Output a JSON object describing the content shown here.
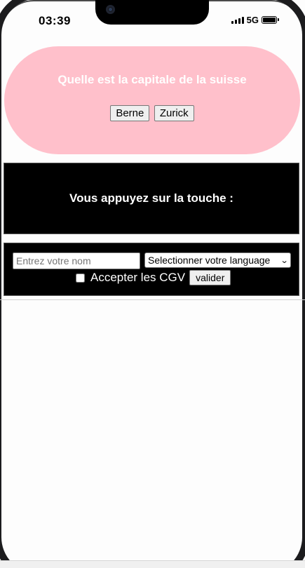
{
  "status_bar": {
    "time": "03:39",
    "network": "5G"
  },
  "quiz": {
    "question": "Quelle est la capitale de la suisse",
    "answers": [
      "Berne",
      "Zurick"
    ],
    "background": "#ffc0cb"
  },
  "key_box": {
    "label": "Vous appuyez sur la touche :"
  },
  "form": {
    "name_placeholder": "Entrez votre nom",
    "language_select_value": "Selectionner votre language",
    "cgv_label": "Accepter les CGV",
    "cgv_checked": false,
    "submit_label": "valider"
  }
}
